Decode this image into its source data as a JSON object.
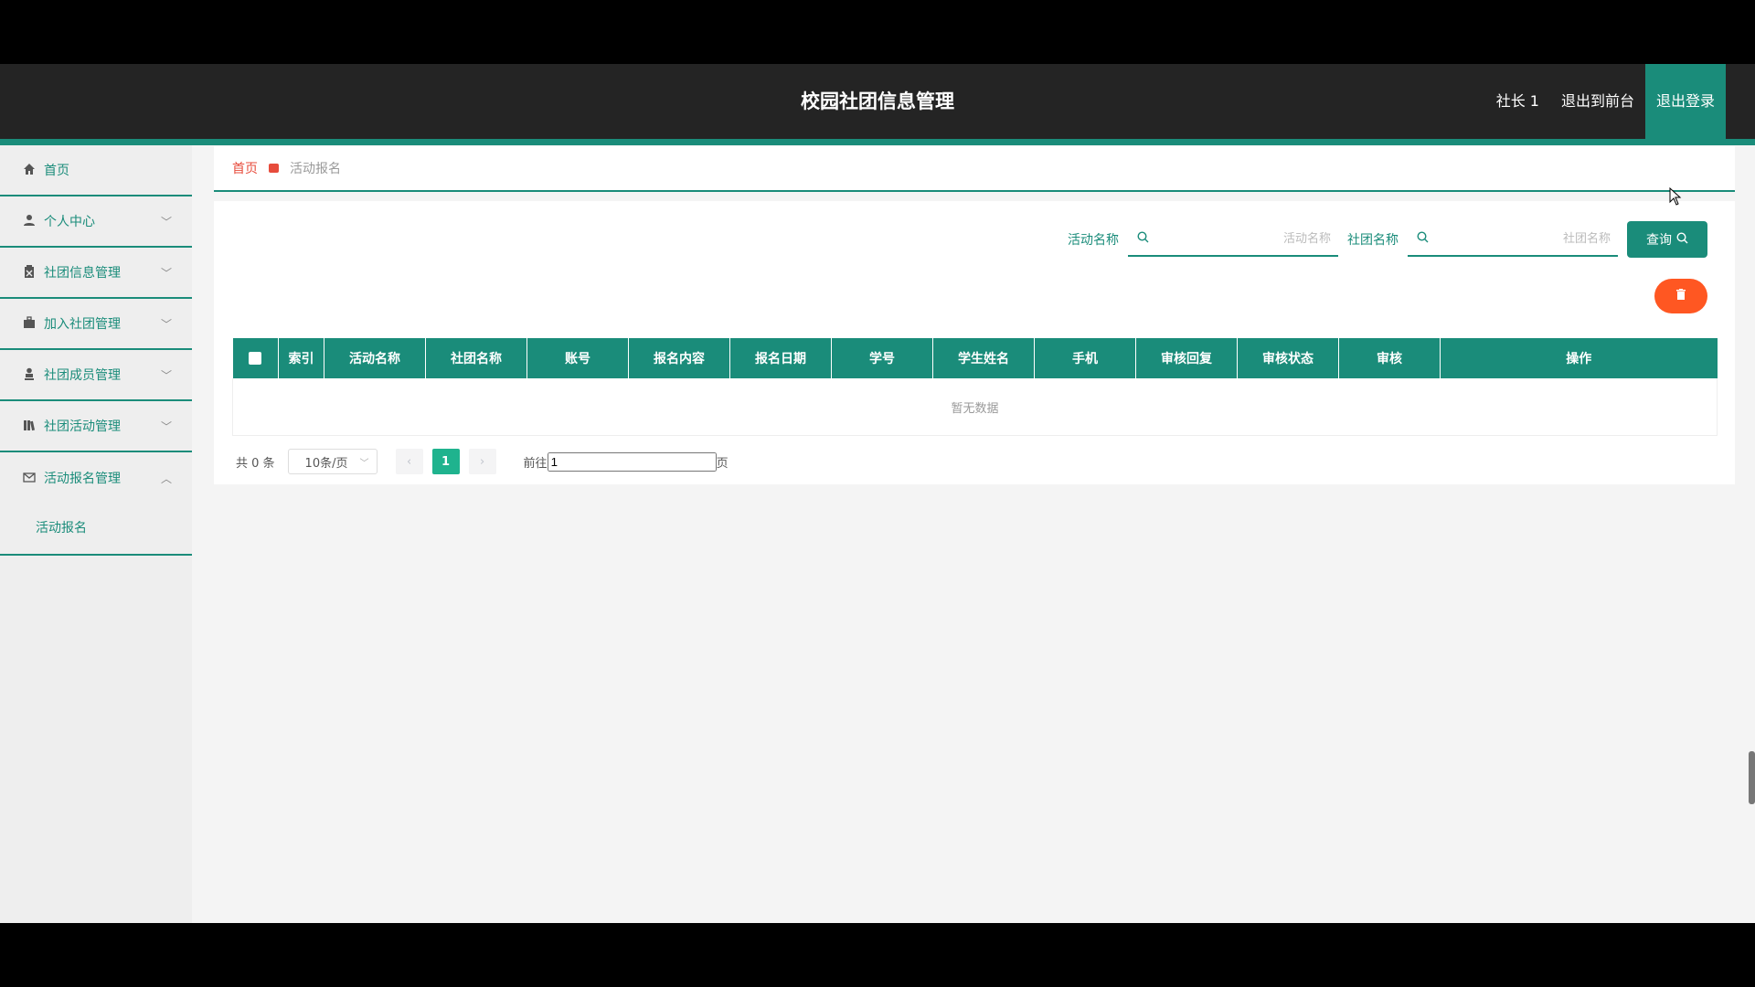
{
  "header": {
    "title": "校园社团信息管理",
    "user": "社长 1",
    "back_to_front": "退出到前台",
    "logout": "退出登录"
  },
  "sidebar": {
    "items": [
      {
        "label": "首页",
        "icon": "home-icon"
      },
      {
        "label": "个人中心",
        "icon": "user-icon"
      },
      {
        "label": "社团信息管理",
        "icon": "clipboard-icon"
      },
      {
        "label": "加入社团管理",
        "icon": "briefcase-icon"
      },
      {
        "label": "社团成员管理",
        "icon": "person-icon"
      },
      {
        "label": "社团活动管理",
        "icon": "library-icon"
      },
      {
        "label": "活动报名管理",
        "icon": "mail-icon"
      }
    ],
    "submenu": {
      "label": "活动报名"
    }
  },
  "breadcrumb": {
    "home": "首页",
    "current": "活动报名"
  },
  "search": {
    "activity_label": "活动名称",
    "activity_placeholder": "活动名称",
    "club_label": "社团名称",
    "club_placeholder": "社团名称",
    "query_button": "查询"
  },
  "table": {
    "columns": [
      "索引",
      "活动名称",
      "社团名称",
      "账号",
      "报名内容",
      "报名日期",
      "学号",
      "学生姓名",
      "手机",
      "审核回复",
      "审核状态",
      "审核",
      "操作"
    ],
    "empty_text": "暂无数据"
  },
  "pagination": {
    "total": "共 0 条",
    "page_size": "10条/页",
    "current_page": "1",
    "goto_prefix": "前往",
    "goto_value": "1",
    "goto_suffix": "页"
  },
  "colors": {
    "accent": "#1a8c7a",
    "danger": "#ff5722",
    "breadcrumb_home": "#e74c3c"
  }
}
